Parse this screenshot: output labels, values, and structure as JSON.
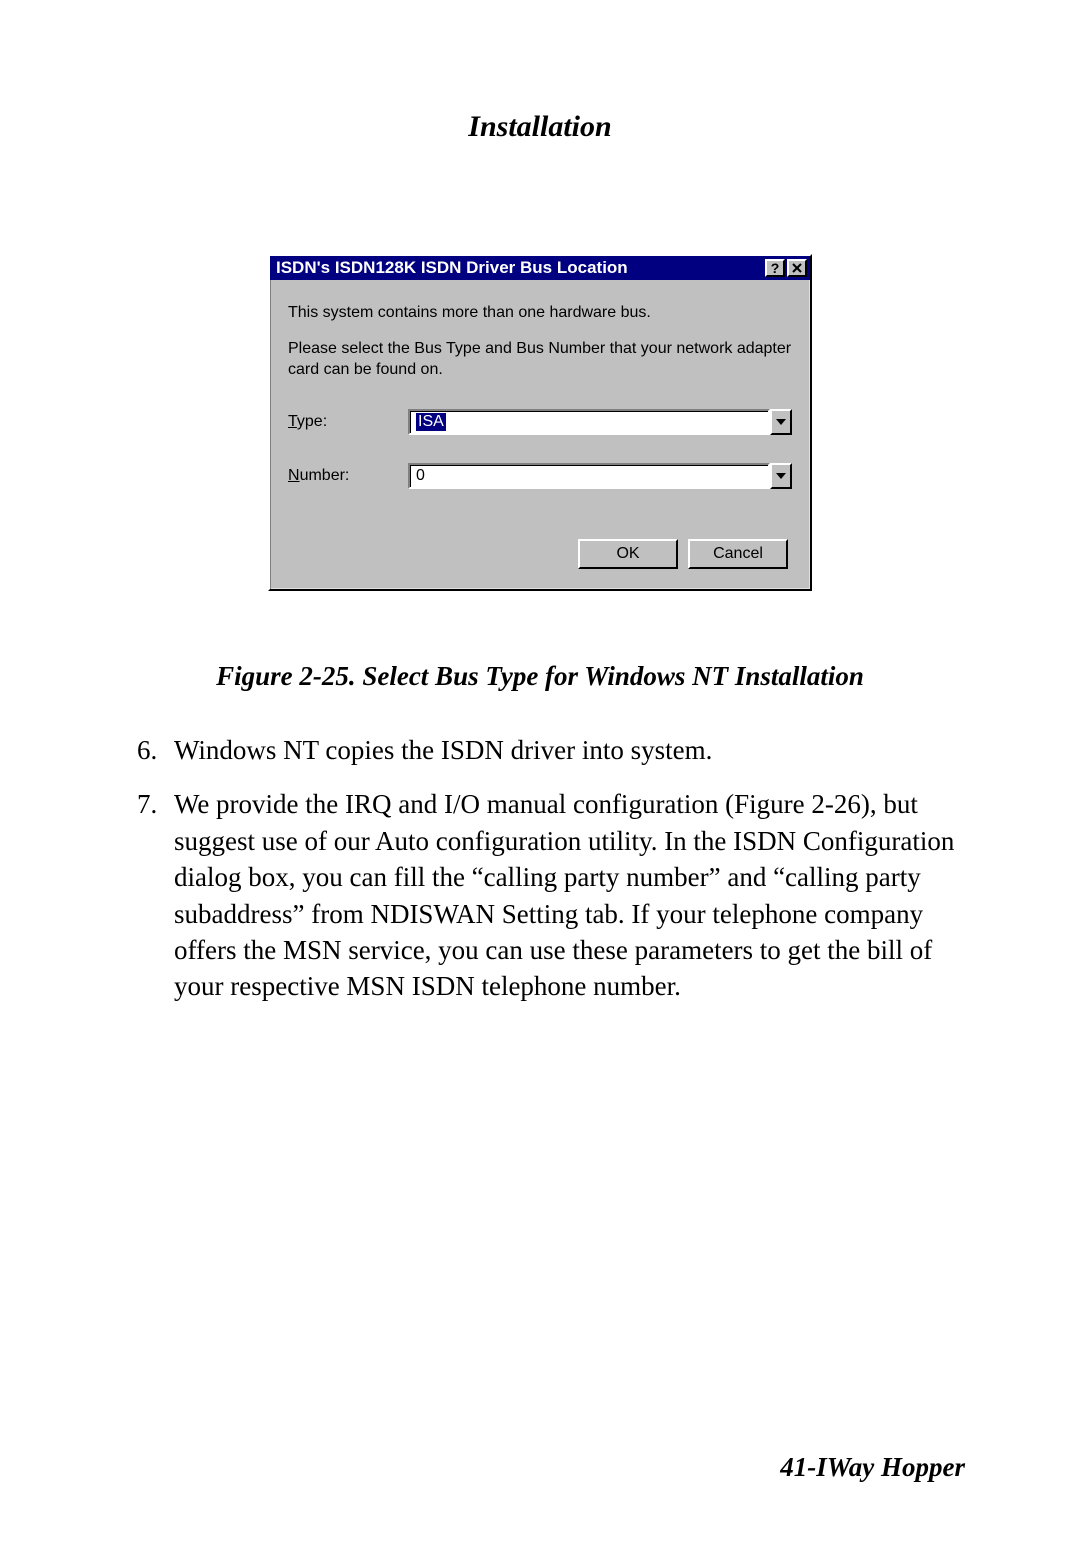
{
  "page": {
    "header_title": "Installation",
    "footer_label": "41-IWay Hopper"
  },
  "dialog": {
    "title": "ISDN's ISDN128K ISDN Driver Bus Location",
    "help_icon_name": "help-icon",
    "close_icon_name": "close-icon",
    "message1": "This system contains more than one hardware bus.",
    "message2": "Please select the Bus Type and Bus Number that your network adapter card can be found on.",
    "fields": {
      "type": {
        "label_underline_char": "T",
        "label_rest": "ype:",
        "value": "ISA"
      },
      "number": {
        "label_underline_char": "N",
        "label_rest": "umber:",
        "value": "0"
      }
    },
    "buttons": {
      "ok": "OK",
      "cancel": "Cancel"
    }
  },
  "figure_caption": "Figure 2-25. Select Bus Type for Windows NT Installation",
  "steps": {
    "start": 6,
    "items": [
      "Windows NT copies the ISDN driver into system.",
      "We provide the IRQ and I/O manual configuration (Figure 2-26), but suggest use of our Auto configuration utility.  In the ISDN Configuration dialog box, you can fill the “calling party number” and “calling party subaddress” from NDISWAN Setting tab.  If your telephone company offers the MSN service, you can use these parameters to get the bill of your respective MSN ISDN telephone number."
    ]
  }
}
